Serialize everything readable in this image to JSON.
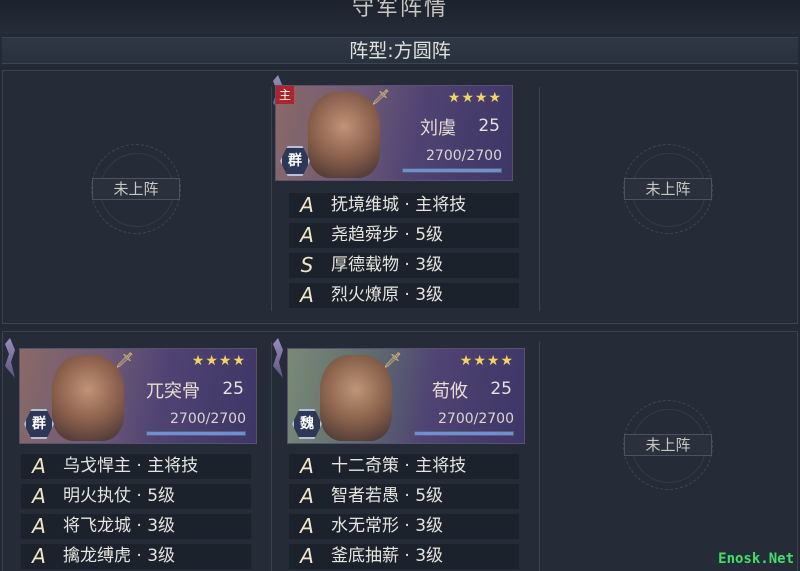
{
  "header": {
    "title": "守军阵情"
  },
  "formation": {
    "label": "阵型:方圆阵"
  },
  "empty_slot_label": "未上阵",
  "generals": [
    {
      "name": "刘虞",
      "level": "25",
      "stars": "★★★★",
      "hp": "2700/2700",
      "hp_fraction": 1.0,
      "faction": "群",
      "leader_badge": "主",
      "skills": [
        {
          "grade": "A",
          "name": "抚境维城 · 主将技"
        },
        {
          "grade": "A",
          "name": "尧趋舜步 · 5级"
        },
        {
          "grade": "S",
          "name": "厚德载物 · 3级"
        },
        {
          "grade": "A",
          "name": "烈火燎原 · 3级"
        }
      ]
    },
    {
      "name": "兀突骨",
      "level": "25",
      "stars": "★★★★",
      "hp": "2700/2700",
      "hp_fraction": 1.0,
      "faction": "群",
      "skills": [
        {
          "grade": "A",
          "name": "乌戈悍主 · 主将技"
        },
        {
          "grade": "A",
          "name": "明火执仗 · 5级"
        },
        {
          "grade": "A",
          "name": "将飞龙城 · 3级"
        },
        {
          "grade": "A",
          "name": "擒龙缚虎 · 3级"
        }
      ]
    },
    {
      "name": "荀攸",
      "level": "25",
      "stars": "★★★★",
      "hp": "2700/2700",
      "hp_fraction": 1.0,
      "faction": "魏",
      "skills": [
        {
          "grade": "A",
          "name": "十二奇策 · 主将技"
        },
        {
          "grade": "A",
          "name": "智者若愚 · 5级"
        },
        {
          "grade": "A",
          "name": "水无常形 · 3级"
        },
        {
          "grade": "A",
          "name": "釜底抽薪 · 3级"
        }
      ]
    }
  ],
  "watermark": "Enosk.Net"
}
